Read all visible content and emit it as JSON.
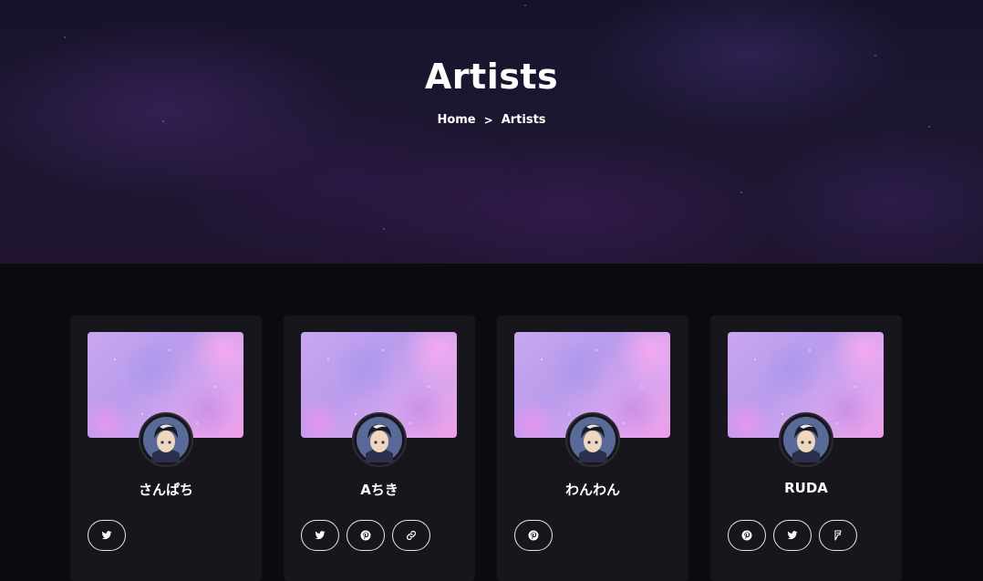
{
  "hero": {
    "title": "Artists",
    "breadcrumb": {
      "home": "Home",
      "separator": ">",
      "current": "Artists"
    }
  },
  "artists": [
    {
      "name": "さんぱち",
      "socials": [
        "twitter-icon"
      ]
    },
    {
      "name": "Aちき",
      "socials": [
        "pinterest-icon",
        "link-icon"
      ],
      "socials_order": [
        "twitter-icon",
        "pinterest-icon",
        "link-icon"
      ]
    },
    {
      "name": "わんわん",
      "socials": [
        "pinterest-icon"
      ]
    },
    {
      "name": "RUDA",
      "socials": [
        "pinterest-icon",
        "twitter-icon",
        "foursquare-icon"
      ]
    }
  ],
  "colors": {
    "page_background": "#0b0a0f",
    "card_background": "#17161c",
    "social_border": "#e6e6ea"
  }
}
